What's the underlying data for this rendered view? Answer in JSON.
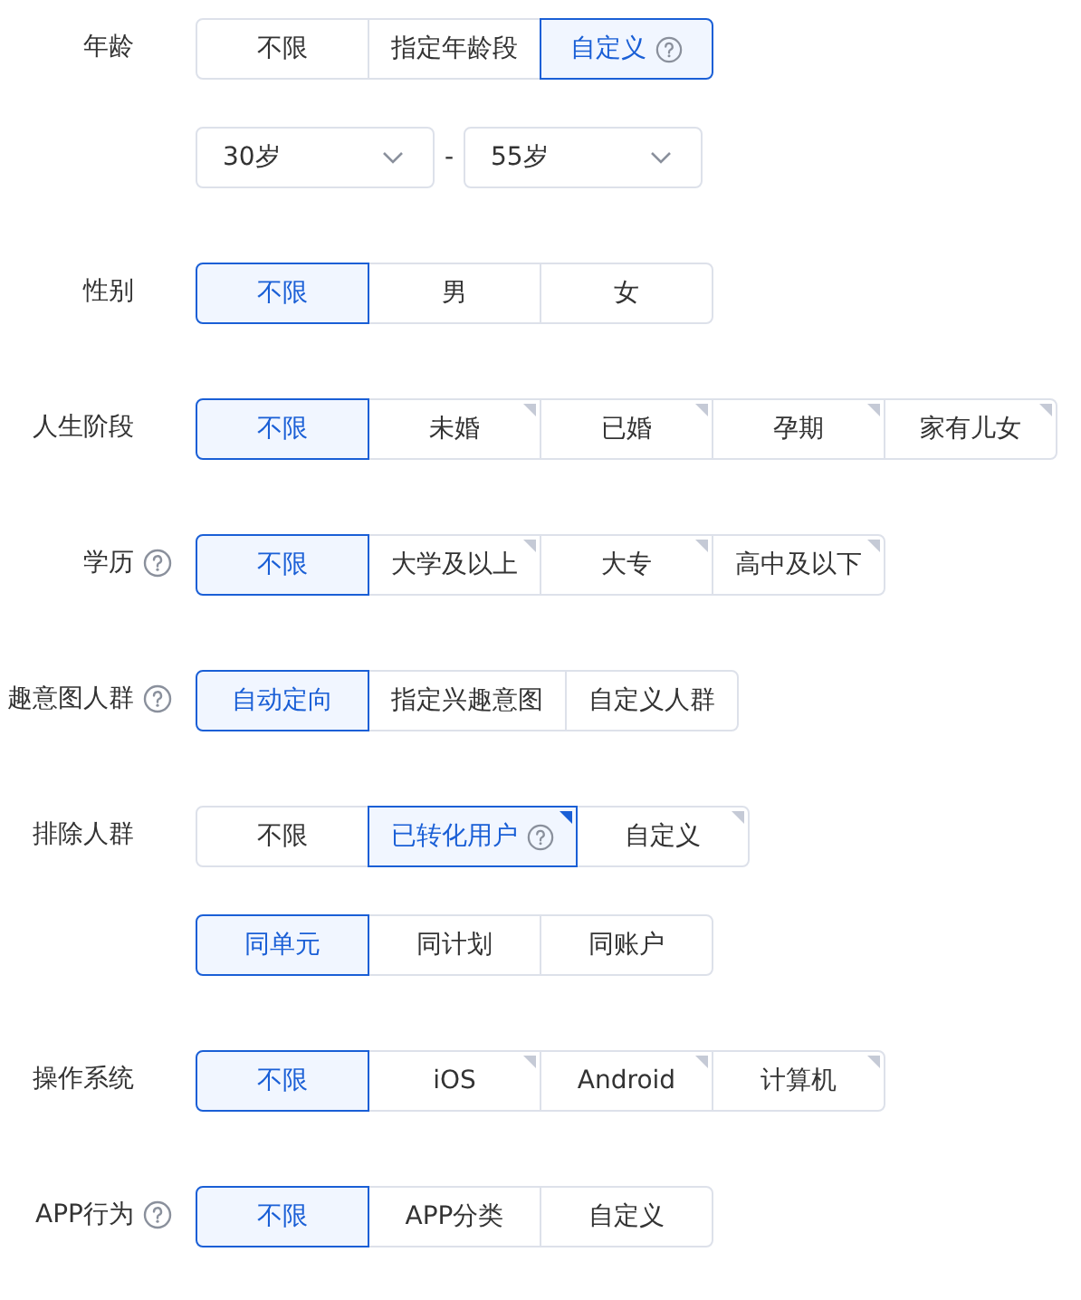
{
  "sections": [
    {
      "label": "年龄",
      "help": false,
      "controls": [
        {
          "kind": "segmented",
          "options": [
            {
              "text": "不限",
              "selected": false,
              "corner": false,
              "help": false
            },
            {
              "text": "指定年龄段",
              "selected": false,
              "corner": false,
              "help": false
            },
            {
              "text": "自定义",
              "selected": true,
              "corner": false,
              "help": true
            }
          ]
        },
        {
          "kind": "range",
          "from": "30岁",
          "separator": "-",
          "to": "55岁"
        }
      ]
    },
    {
      "label": "性别",
      "help": false,
      "controls": [
        {
          "kind": "segmented",
          "options": [
            {
              "text": "不限",
              "selected": true,
              "corner": false,
              "help": false
            },
            {
              "text": "男",
              "selected": false,
              "corner": false,
              "help": false
            },
            {
              "text": "女",
              "selected": false,
              "corner": false,
              "help": false
            }
          ]
        }
      ]
    },
    {
      "label": "人生阶段",
      "help": false,
      "controls": [
        {
          "kind": "segmented",
          "options": [
            {
              "text": "不限",
              "selected": true,
              "corner": false,
              "help": false
            },
            {
              "text": "未婚",
              "selected": false,
              "corner": true,
              "help": false
            },
            {
              "text": "已婚",
              "selected": false,
              "corner": true,
              "help": false
            },
            {
              "text": "孕期",
              "selected": false,
              "corner": true,
              "help": false
            },
            {
              "text": "家有儿女",
              "selected": false,
              "corner": true,
              "help": false
            }
          ]
        }
      ]
    },
    {
      "label": "学历",
      "help": true,
      "controls": [
        {
          "kind": "segmented",
          "options": [
            {
              "text": "不限",
              "selected": true,
              "corner": false,
              "help": false
            },
            {
              "text": "大学及以上",
              "selected": false,
              "corner": true,
              "help": false
            },
            {
              "text": "大专",
              "selected": false,
              "corner": true,
              "help": false
            },
            {
              "text": "高中及以下",
              "selected": false,
              "corner": true,
              "help": false
            }
          ]
        }
      ]
    },
    {
      "label": "趣意图人群",
      "help": true,
      "controls": [
        {
          "kind": "segmented",
          "options": [
            {
              "text": "自动定向",
              "selected": true,
              "corner": false,
              "help": false
            },
            {
              "text": "指定兴趣意图",
              "selected": false,
              "corner": false,
              "help": false
            },
            {
              "text": "自定义人群",
              "selected": false,
              "corner": false,
              "help": false
            }
          ]
        }
      ]
    },
    {
      "label": "排除人群",
      "help": false,
      "controls": [
        {
          "kind": "segmented",
          "options": [
            {
              "text": "不限",
              "selected": false,
              "corner": false,
              "help": false
            },
            {
              "text": "已转化用户",
              "selected": true,
              "corner": true,
              "help": true
            },
            {
              "text": "自定义",
              "selected": false,
              "corner": true,
              "help": false
            }
          ]
        },
        {
          "kind": "segmented",
          "options": [
            {
              "text": "同单元",
              "selected": true,
              "corner": false,
              "help": false
            },
            {
              "text": "同计划",
              "selected": false,
              "corner": false,
              "help": false
            },
            {
              "text": "同账户",
              "selected": false,
              "corner": false,
              "help": false
            }
          ]
        }
      ]
    },
    {
      "label": "操作系统",
      "help": false,
      "controls": [
        {
          "kind": "segmented",
          "options": [
            {
              "text": "不限",
              "selected": true,
              "corner": false,
              "help": false
            },
            {
              "text": "iOS",
              "selected": false,
              "corner": true,
              "help": false
            },
            {
              "text": "Android",
              "selected": false,
              "corner": true,
              "help": false
            },
            {
              "text": "计算机",
              "selected": false,
              "corner": true,
              "help": false
            }
          ]
        }
      ]
    },
    {
      "label": "APP行为",
      "help": true,
      "controls": [
        {
          "kind": "segmented",
          "options": [
            {
              "text": "不限",
              "selected": true,
              "corner": false,
              "help": false
            },
            {
              "text": "APP分类",
              "selected": false,
              "corner": false,
              "help": false
            },
            {
              "text": "自定义",
              "selected": false,
              "corner": false,
              "help": false
            }
          ]
        }
      ]
    }
  ]
}
